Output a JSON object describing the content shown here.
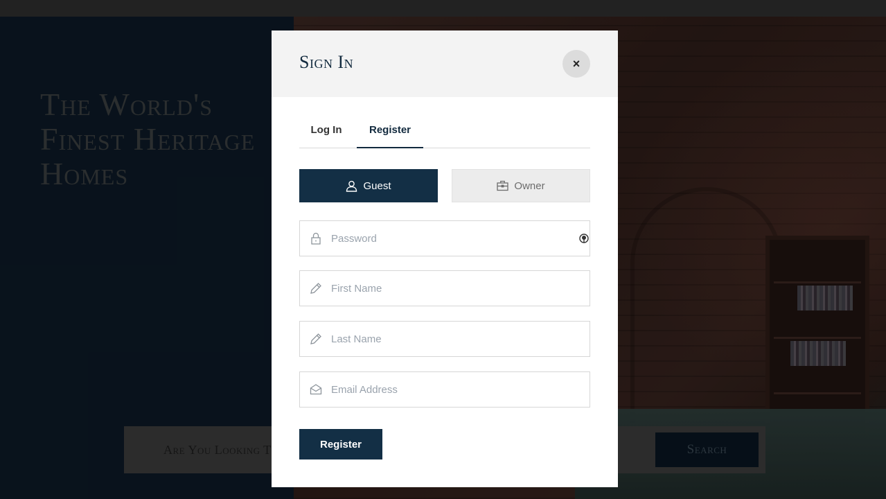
{
  "background": {
    "hero_title": "The World's Finest Heritage Homes",
    "search": {
      "placeholder": "Are You Looking T",
      "button_label": "Search"
    }
  },
  "modal": {
    "title": "Sign In",
    "close_label": "×",
    "tabs": [
      {
        "label": "Log In",
        "active": false
      },
      {
        "label": "Register",
        "active": true
      }
    ],
    "roles": [
      {
        "label": "Guest",
        "icon": "user-icon",
        "selected": true
      },
      {
        "label": "Owner",
        "icon": "briefcase-icon",
        "selected": false
      }
    ],
    "fields": {
      "password": {
        "placeholder": "Password",
        "icon": "lock-icon"
      },
      "first_name": {
        "placeholder": "First Name",
        "icon": "pencil-icon"
      },
      "last_name": {
        "placeholder": "Last Name",
        "icon": "pencil-icon"
      },
      "email": {
        "placeholder": "Email Address",
        "icon": "envelope-icon"
      }
    },
    "submit_label": "Register"
  },
  "colors": {
    "primary": "#132f45",
    "header_bg": "#f3f3f3",
    "placeholder": "#9aa3ad"
  }
}
